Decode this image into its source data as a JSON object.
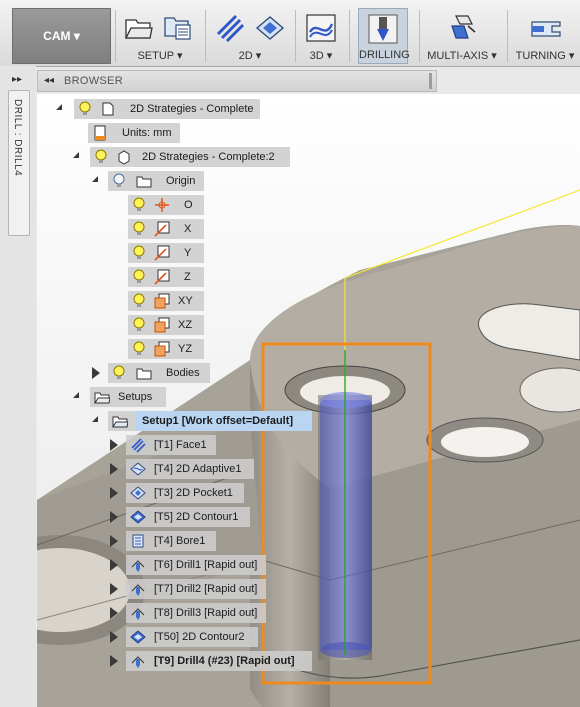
{
  "toolbar": {
    "workspace_label": "CAM ▾",
    "groups": [
      {
        "label": "SETUP ▾"
      },
      {
        "label": "2D ▾"
      },
      {
        "label": "3D ▾"
      },
      {
        "label": "DRILLING"
      },
      {
        "label": "MULTI-AXIS ▾"
      },
      {
        "label": "TURNING ▾"
      }
    ]
  },
  "side_tab": {
    "label": "DRILL : DRILL4"
  },
  "browser": {
    "title": "BROWSER",
    "items": [
      {
        "label": "2D Strategies - Complete"
      },
      {
        "label": "Units: mm"
      },
      {
        "label": "2D Strategies - Complete:2"
      },
      {
        "label": "Origin"
      },
      {
        "label": "O"
      },
      {
        "label": "X"
      },
      {
        "label": "Y"
      },
      {
        "label": "Z"
      },
      {
        "label": "XY"
      },
      {
        "label": "XZ"
      },
      {
        "label": "YZ"
      },
      {
        "label": "Bodies"
      },
      {
        "label": "Setups"
      },
      {
        "label": "Setup1 [Work offset=Default]"
      },
      {
        "label": "[T1] Face1"
      },
      {
        "label": "[T4] 2D Adaptive1"
      },
      {
        "label": "[T3] 2D Pocket1"
      },
      {
        "label": "[T5] 2D Contour1"
      },
      {
        "label": "[T4] Bore1"
      },
      {
        "label": "[T6] Drill1 [Rapid out]"
      },
      {
        "label": "[T7] Drill2 [Rapid out]"
      },
      {
        "label": "[T8] Drill3 [Rapid out]"
      },
      {
        "label": "[T50] 2D Contour2"
      },
      {
        "label": "[T9] Drill4 (#23) [Rapid out]"
      }
    ]
  },
  "colors": {
    "accent_orange": "#f08a1c",
    "selection_blue": "#b9d5f1",
    "tool_blue": "#4e5fd6"
  }
}
